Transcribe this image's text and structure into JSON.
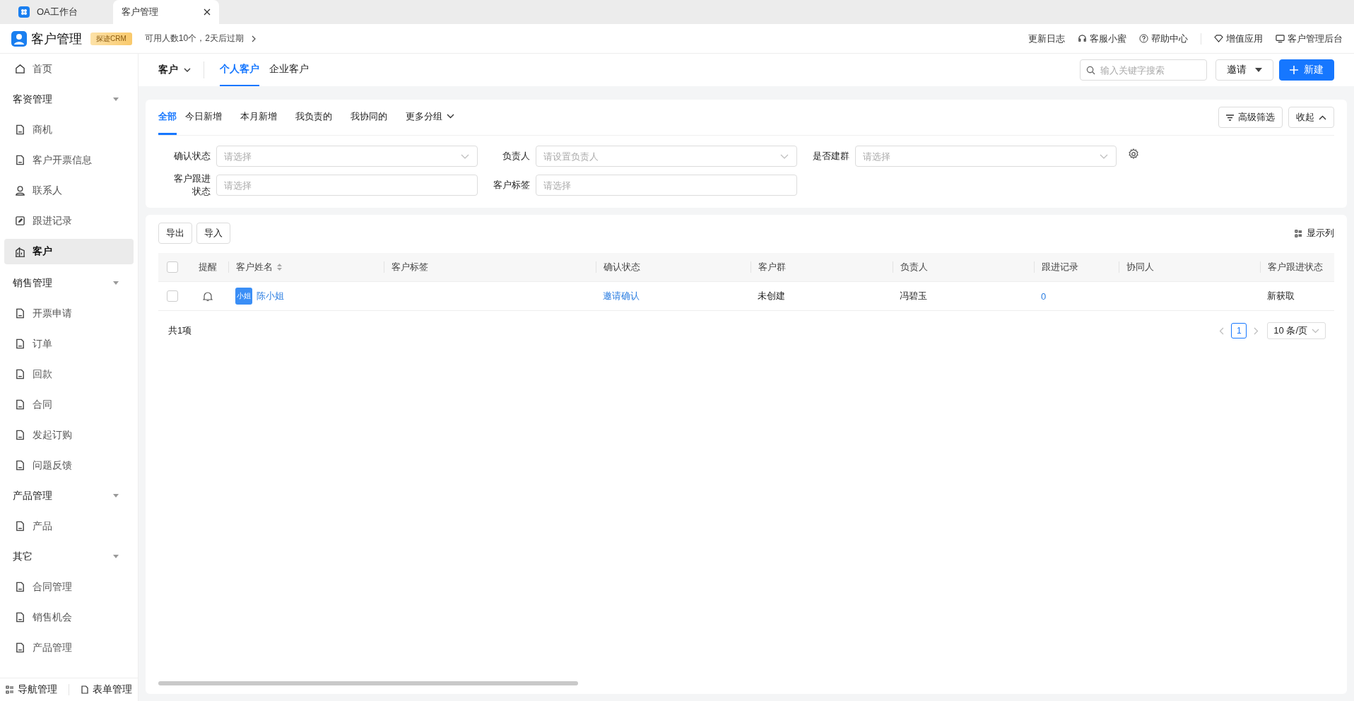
{
  "browser_tabs": [
    {
      "label": "OA工作台",
      "selected": false
    },
    {
      "label": "客户管理",
      "selected": true
    }
  ],
  "app": {
    "title": "客户管理",
    "badge": "探迹CRM",
    "license": "可用人数10个，2天后过期"
  },
  "header_links": [
    {
      "label": "更新日志",
      "kind": "none"
    },
    {
      "label": "客服小蜜",
      "kind": "headset"
    },
    {
      "label": "帮助中心",
      "kind": "help"
    },
    {
      "label": "增值应用",
      "kind": "diamond"
    },
    {
      "label": "客户管理后台",
      "kind": "monitor"
    }
  ],
  "sidebar": {
    "items": [
      {
        "label": "首页",
        "kind": "home",
        "selected": false
      },
      {
        "label": "客资管理",
        "kind": "group",
        "expanded": true,
        "children": [
          {
            "label": "商机",
            "kind": "doc",
            "selected": false
          },
          {
            "label": "客户开票信息",
            "kind": "doc",
            "selected": false
          },
          {
            "label": "联系人",
            "kind": "person",
            "selected": false
          },
          {
            "label": "跟进记录",
            "kind": "edit",
            "selected": false
          },
          {
            "label": "客户",
            "kind": "building",
            "selected": true
          }
        ]
      },
      {
        "label": "销售管理",
        "kind": "group",
        "expanded": true,
        "children": [
          {
            "label": "开票申请",
            "kind": "doc",
            "selected": false
          },
          {
            "label": "订单",
            "kind": "doc",
            "selected": false
          },
          {
            "label": "回款",
            "kind": "doc",
            "selected": false
          },
          {
            "label": "合同",
            "kind": "doc",
            "selected": false
          },
          {
            "label": "发起订购",
            "kind": "doc",
            "selected": false
          },
          {
            "label": "问题反馈",
            "kind": "doc",
            "selected": false
          }
        ]
      },
      {
        "label": "产品管理",
        "kind": "group",
        "expanded": true,
        "children": [
          {
            "label": "产品",
            "kind": "doc",
            "selected": false
          }
        ]
      },
      {
        "label": "其它",
        "kind": "group",
        "expanded": true,
        "children": [
          {
            "label": "合同管理",
            "kind": "doc",
            "selected": false
          },
          {
            "label": "销售机会",
            "kind": "doc",
            "selected": false
          },
          {
            "label": "产品管理",
            "kind": "doc",
            "selected": false
          }
        ]
      }
    ],
    "footer": [
      {
        "label": "导航管理",
        "kind": "grid"
      },
      {
        "label": "表单管理",
        "kind": "doc"
      }
    ]
  },
  "topnav": {
    "module": "客户",
    "tabs": [
      {
        "label": "个人客户",
        "selected": true
      },
      {
        "label": "企业客户",
        "selected": false
      }
    ],
    "search": {
      "placeholder": "输入关键字搜索"
    },
    "invite": "邀请",
    "new": "新建"
  },
  "filter": {
    "tabs": [
      {
        "label": "全部",
        "selected": true
      },
      {
        "label": "今日新增",
        "selected": false
      },
      {
        "label": "本月新增",
        "selected": false
      },
      {
        "label": "我负责的",
        "selected": false
      },
      {
        "label": "我协同的",
        "selected": false
      }
    ],
    "more": "更多分组",
    "advanced": "高级筛选",
    "collapse": "收起",
    "fields": [
      {
        "label": "确认状态",
        "placeholder": "请选择",
        "kind": "select"
      },
      {
        "label": "负责人",
        "placeholder": "请设置负责人",
        "kind": "select"
      },
      {
        "label": "是否建群",
        "placeholder": "请选择",
        "kind": "select"
      },
      {
        "label": "客户跟进状态",
        "placeholder": "请选择",
        "kind": "input"
      },
      {
        "label": "客户标签",
        "placeholder": "请选择",
        "kind": "input"
      }
    ]
  },
  "table": {
    "export": "导出",
    "import": "导入",
    "show_columns": "显示列",
    "select_all": {
      "checked": false
    },
    "columns": [
      {
        "label": "提醒",
        "kind": "reminder"
      },
      {
        "label": "客户姓名",
        "kind": "name",
        "sortable": true
      },
      {
        "label": "客户标签",
        "kind": "tags"
      },
      {
        "label": "确认状态",
        "kind": "confirm"
      },
      {
        "label": "客户群",
        "kind": "group"
      },
      {
        "label": "负责人",
        "kind": "owner"
      },
      {
        "label": "跟进记录",
        "kind": "followups"
      },
      {
        "label": "协同人",
        "kind": "collab"
      },
      {
        "label": "客户跟进状态",
        "kind": "status"
      }
    ],
    "rows": [
      {
        "checked": false,
        "avatar": "小姐",
        "name": "陈小姐",
        "confirm": "邀请确认",
        "group": "未创建",
        "owner": "冯碧玉",
        "followups": "0",
        "status": "新获取"
      }
    ]
  },
  "pagination": {
    "total": "共1项",
    "pages": [
      {
        "label": "1",
        "selected": true
      }
    ],
    "page_size": "10 条/页"
  }
}
